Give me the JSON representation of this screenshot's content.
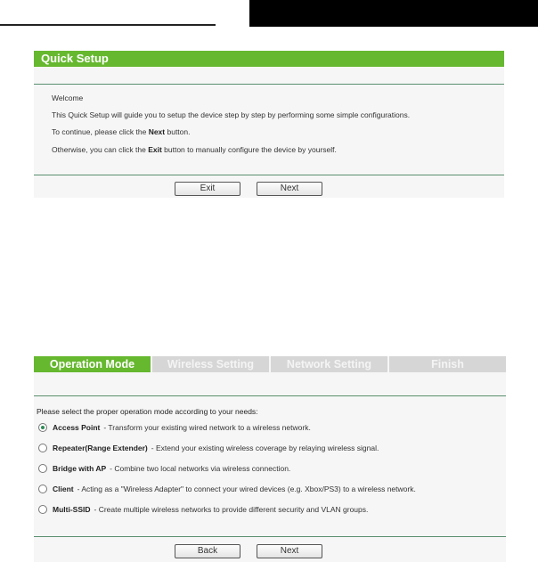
{
  "quick_setup": {
    "title": "Quick Setup",
    "welcome": "Welcome",
    "line1": "This Quick Setup will guide you to setup the device step by step by performing some simple configurations.",
    "line2_pre": "To continue, please click the ",
    "line2_bold": "Next",
    "line2_post": " button.",
    "line3_pre": "Otherwise, you can click the ",
    "line3_bold": "Exit",
    "line3_post": " button to manually configure the device by yourself.",
    "exit_label": "Exit",
    "next_label": "Next"
  },
  "operation_mode": {
    "tabs": [
      {
        "label": "Operation Mode",
        "active": true
      },
      {
        "label": "Wireless Setting",
        "active": false
      },
      {
        "label": "Network Setting",
        "active": false
      },
      {
        "label": "Finish",
        "active": false
      }
    ],
    "prompt": "Please select the proper operation mode according to your needs:",
    "options": [
      {
        "name": "Access Point",
        "desc": " - Transform your existing wired network to a wireless network.",
        "checked": true
      },
      {
        "name": "Repeater(Range Extender)",
        "desc": " - Extend your existing wireless coverage by relaying wireless signal.",
        "checked": false
      },
      {
        "name": "Bridge with AP",
        "desc": " - Combine two local networks via wireless connection.",
        "checked": false
      },
      {
        "name": "Client",
        "desc": " - Acting as a \"Wireless Adapter\" to connect your wired devices (e.g. Xbox/PS3) to a wireless network.",
        "checked": false
      },
      {
        "name": "Multi-SSID",
        "desc": " - Create multiple wireless networks to provide different security and VLAN groups.",
        "checked": false
      }
    ],
    "back_label": "Back",
    "next_label": "Next"
  },
  "colors": {
    "accent_green": "#66b82f",
    "inactive_tab": "#d6d6d6",
    "rule": "#5a8f6e"
  }
}
